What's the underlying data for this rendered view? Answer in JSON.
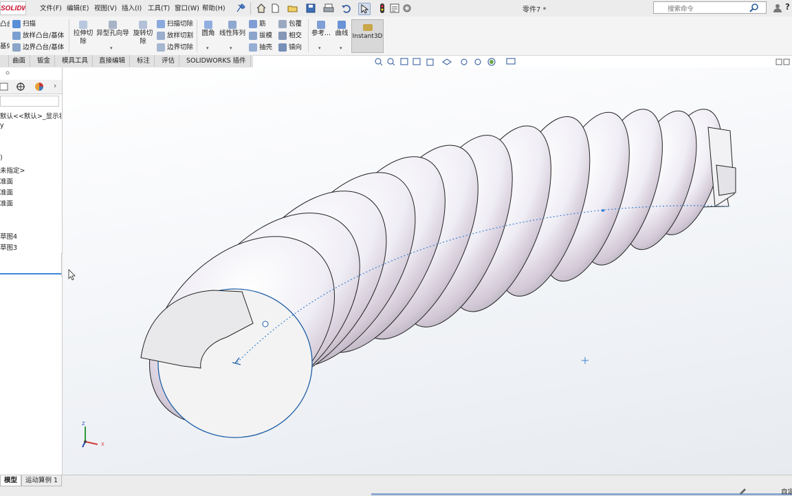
{
  "app": {
    "logo_text": "SOLIDWORKS",
    "document_title": "零件7 *",
    "accent_color": "#c8102e"
  },
  "menu": {
    "items": [
      "文件(F)",
      "编辑(E)",
      "视图(V)",
      "插入(I)",
      "工具(T)",
      "窗口(W)",
      "帮助(H)"
    ]
  },
  "search": {
    "placeholder": "搜索命令"
  },
  "help_glyph": "?",
  "commands": {
    "sweep": "扫描",
    "loft_boss": "放样凸台/基体",
    "boundary_boss": "边界凸台/基体",
    "boss_partial_1": "凸台",
    "boss_partial_2": "基体",
    "extruded_cut_1": "拉伸切",
    "extruded_cut_2": "除",
    "hole_wizard": "异型孔向导",
    "revolved_cut_1": "旋转切",
    "revolved_cut_2": "除",
    "swept_cut": "扫描切除",
    "lofted_cut": "放样切割",
    "boundary_cut": "边界切除",
    "fillet": "圆角",
    "linear_pattern": "线性阵列",
    "rib": "筋",
    "draft": "拔模",
    "shell": "抽壳",
    "wrap": "包覆",
    "intersect": "相交",
    "mirror": "镜向",
    "reference": "参考...",
    "curves": "曲线",
    "instant3d": "Instant3D"
  },
  "tabs": [
    "曲面",
    "钣金",
    "模具工具",
    "直接编辑",
    "标注",
    "评估",
    "SOLIDWORKS 插件"
  ],
  "tree": {
    "config_line": "默认<<默认>_显示状",
    "history": "y",
    "sensors": ")",
    "material": "未指定>",
    "front_plane": "准面",
    "top_plane": "准面",
    "right_plane": "准面",
    "sketch4": "草图4",
    "sketch3": "草图3"
  },
  "bottom_tabs": [
    "模型",
    "运动算例 1"
  ],
  "status": {
    "right_text": "自定"
  },
  "triad": {
    "x": "X",
    "y": "Y",
    "z": "Z"
  }
}
